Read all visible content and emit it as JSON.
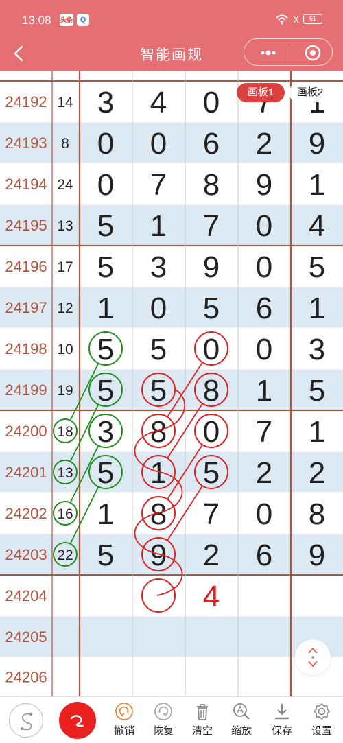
{
  "status": {
    "time": "13:08",
    "app_badge_1": "头条",
    "app_badge_2": "Q",
    "signal": "X",
    "battery": "61"
  },
  "nav": {
    "title": "智能画规"
  },
  "tabs": [
    {
      "label": "画板1",
      "active": true
    },
    {
      "label": "画板2",
      "active": false
    }
  ],
  "rows": [
    {
      "id": "",
      "sum": "",
      "digits": [
        "",
        "",
        "",
        "",
        ""
      ]
    },
    {
      "id": "24192",
      "sum": "14",
      "digits": [
        "3",
        "4",
        "0",
        "7",
        "1"
      ]
    },
    {
      "id": "24193",
      "sum": "8",
      "digits": [
        "0",
        "0",
        "6",
        "2",
        "9"
      ]
    },
    {
      "id": "24194",
      "sum": "24",
      "digits": [
        "0",
        "7",
        "8",
        "9",
        "1"
      ]
    },
    {
      "id": "24195",
      "sum": "13",
      "digits": [
        "5",
        "1",
        "7",
        "0",
        "4"
      ]
    },
    {
      "id": "24196",
      "sum": "17",
      "digits": [
        "5",
        "3",
        "9",
        "0",
        "5"
      ]
    },
    {
      "id": "24197",
      "sum": "12",
      "digits": [
        "1",
        "0",
        "5",
        "6",
        "1"
      ]
    },
    {
      "id": "24198",
      "sum": "10",
      "digits": [
        "5",
        "5",
        "0",
        "0",
        "3"
      ]
    },
    {
      "id": "24199",
      "sum": "19",
      "digits": [
        "5",
        "5",
        "8",
        "1",
        "5"
      ]
    },
    {
      "id": "24200",
      "sum": "18",
      "digits": [
        "3",
        "8",
        "0",
        "7",
        "1"
      ]
    },
    {
      "id": "24201",
      "sum": "13",
      "digits": [
        "5",
        "1",
        "5",
        "2",
        "2"
      ]
    },
    {
      "id": "24202",
      "sum": "16",
      "digits": [
        "1",
        "8",
        "7",
        "0",
        "8"
      ]
    },
    {
      "id": "24203",
      "sum": "22",
      "digits": [
        "5",
        "9",
        "2",
        "6",
        "9"
      ]
    },
    {
      "id": "24204",
      "sum": "",
      "digits": [
        "",
        "",
        "4",
        "",
        ""
      ]
    },
    {
      "id": "24205",
      "sum": "",
      "digits": [
        "",
        "",
        "",
        "",
        ""
      ]
    },
    {
      "id": "24206",
      "sum": "",
      "digits": [
        "",
        "",
        "",
        "",
        ""
      ]
    }
  ],
  "circles": {
    "green": [
      [
        7,
        1
      ],
      [
        8,
        1
      ],
      [
        9,
        1
      ],
      [
        10,
        1
      ],
      [
        9,
        0
      ],
      [
        10,
        0
      ],
      [
        11,
        0
      ],
      [
        12,
        0
      ]
    ],
    "red": [
      [
        7,
        3
      ],
      [
        8,
        3
      ],
      [
        9,
        3
      ],
      [
        10,
        3
      ],
      [
        8,
        2
      ],
      [
        9,
        2
      ],
      [
        10,
        2
      ],
      [
        11,
        2
      ],
      [
        12,
        2
      ],
      [
        13,
        2
      ]
    ]
  },
  "lines": {
    "green": [
      [
        [
          9,
          0
        ],
        [
          7,
          1
        ]
      ],
      [
        [
          10,
          0
        ],
        [
          8,
          1
        ]
      ],
      [
        [
          11,
          0
        ],
        [
          9,
          1
        ]
      ],
      [
        [
          12,
          0
        ],
        [
          10,
          1
        ]
      ]
    ],
    "red": [
      [
        [
          9,
          2
        ],
        [
          7,
          3
        ]
      ],
      [
        [
          10,
          2
        ],
        [
          8,
          3
        ]
      ],
      [
        [
          11,
          2
        ],
        [
          9,
          3
        ]
      ],
      [
        [
          12,
          2
        ],
        [
          10,
          3
        ]
      ]
    ],
    "red_zigzag": [
      [
        8,
        2
      ],
      [
        9,
        2
      ],
      [
        10,
        2
      ],
      [
        11,
        2
      ],
      [
        12,
        2
      ],
      [
        13,
        2
      ]
    ]
  },
  "colors": {
    "header": "#e56f73",
    "row_alt": "#dce9f3",
    "grid_line": "#b5533c",
    "row_id": "#b5533c",
    "green": "#1e8f1e",
    "red": "#e02020",
    "active_tab": "#d9403f"
  },
  "toolbar": [
    {
      "key": "undo",
      "label": "撤销",
      "icon": "undo-icon"
    },
    {
      "key": "redo",
      "label": "恢复",
      "icon": "redo-icon"
    },
    {
      "key": "clear",
      "label": "清空",
      "icon": "trash-icon"
    },
    {
      "key": "zoom",
      "label": "缩放",
      "icon": "magnifier-icon"
    },
    {
      "key": "save",
      "label": "保存",
      "icon": "download-icon"
    },
    {
      "key": "settings",
      "label": "设置",
      "icon": "gear-icon"
    }
  ]
}
